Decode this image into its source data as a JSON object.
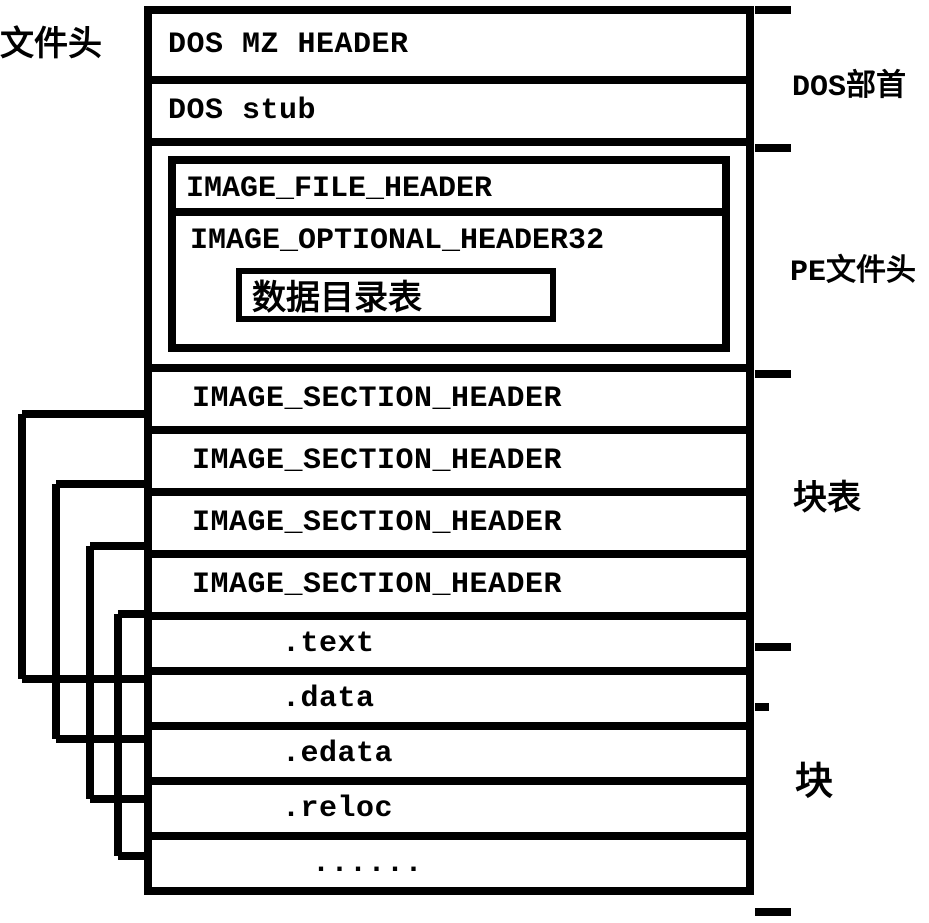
{
  "labels": {
    "file_header": "文件头",
    "dos_head": "DOS部首",
    "pe_head": "PE文件头",
    "section_table": "块表",
    "sections": "块"
  },
  "rows": {
    "dos_mz": "DOS MZ HEADER",
    "dos_stub": "DOS stub",
    "image_file_header": "IMAGE_FILE_HEADER",
    "image_optional_header": "IMAGE_OPTIONAL_HEADER32",
    "data_dir_table": "数据目录表",
    "section_headers": [
      "IMAGE_SECTION_HEADER",
      "IMAGE_SECTION_HEADER",
      "IMAGE_SECTION_HEADER",
      "IMAGE_SECTION_HEADER"
    ],
    "sections": [
      ".text",
      ".data",
      ".edata",
      ".reloc",
      "......"
    ]
  }
}
